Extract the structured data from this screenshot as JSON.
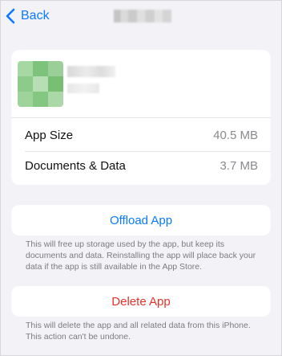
{
  "nav": {
    "back_label": "Back",
    "title": ""
  },
  "app_info": {
    "rows": [
      {
        "label": "App Size",
        "value": "40.5 MB"
      },
      {
        "label": "Documents & Data",
        "value": "3.7 MB"
      }
    ]
  },
  "actions": {
    "offload": {
      "label": "Offload App",
      "note": "This will free up storage used by the app, but keep its documents and data. Reinstalling the app will place back your data if the app is still available in the App Store."
    },
    "delete": {
      "label": "Delete App",
      "note": "This will delete the app and all related data from this iPhone. This action can't be undone."
    }
  },
  "colors": {
    "accent": "#0a7aff",
    "destructive": "#e5332a",
    "background": "#f2f2f7"
  },
  "icons": {
    "back": "chevron-left-icon"
  }
}
